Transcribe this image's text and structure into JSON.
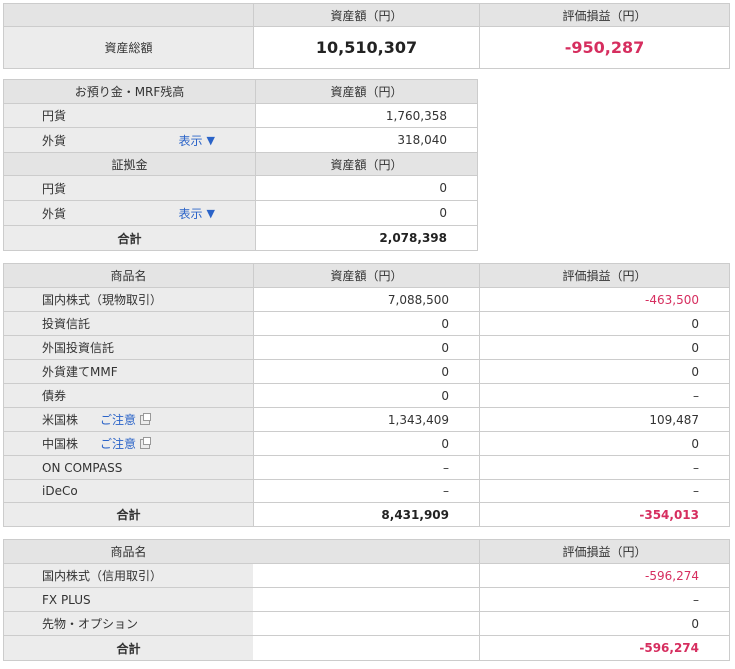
{
  "summary": {
    "col_asset": "資産額（円）",
    "col_pl": "評価損益（円）",
    "label": "資産総額",
    "asset": "10,510,307",
    "pl": "-950,287"
  },
  "deposit": {
    "header_label": "お預り金・MRF残高",
    "header_asset": "資産額（円）",
    "yen_label": "円貨",
    "yen_value": "1,760,358",
    "fx_label": "外貨",
    "fx_toggle": "表示",
    "fx_value": "318,040",
    "margin_header_label": "証拠金",
    "margin_header_asset": "資産額（円）",
    "m_yen_label": "円貨",
    "m_yen_value": "0",
    "m_fx_label": "外貨",
    "m_fx_toggle": "表示",
    "m_fx_value": "0",
    "total_label": "合計",
    "total_value": "2,078,398"
  },
  "products": {
    "header_name": "商品名",
    "header_asset": "資産額（円）",
    "header_pl": "評価損益（円）",
    "caution_label": "ご注意",
    "rows": [
      {
        "name": "国内株式（現物取引）",
        "asset": "7,088,500",
        "pl": "-463,500"
      },
      {
        "name": "投資信託",
        "asset": "0",
        "pl": "0"
      },
      {
        "name": "外国投資信託",
        "asset": "0",
        "pl": "0"
      },
      {
        "name": "外貨建てMMF",
        "asset": "0",
        "pl": "0"
      },
      {
        "name": "債券",
        "asset": "0",
        "pl": "–"
      },
      {
        "name": "米国株",
        "asset": "1,343,409",
        "pl": "109,487"
      },
      {
        "name": "中国株",
        "asset": "0",
        "pl": "0"
      },
      {
        "name": "ON COMPASS",
        "asset": "–",
        "pl": "–"
      },
      {
        "name": "iDeCo",
        "asset": "–",
        "pl": "–"
      }
    ],
    "total_label": "合計",
    "total_asset": "8,431,909",
    "total_pl": "-354,013"
  },
  "margin_products": {
    "header_name": "商品名",
    "header_pl": "評価損益（円）",
    "rows": [
      {
        "name": "国内株式（信用取引）",
        "pl": "-596,274"
      },
      {
        "name": "FX PLUS",
        "pl": "–"
      },
      {
        "name": "先物・オプション",
        "pl": "0"
      }
    ],
    "total_label": "合計",
    "total_pl": "-596,274"
  },
  "colors": {
    "negative": "#d62e5f",
    "link": "#2a63c8",
    "header_bg": "#e4e4e4",
    "label_bg": "#ececec",
    "border": "#cccccc"
  }
}
